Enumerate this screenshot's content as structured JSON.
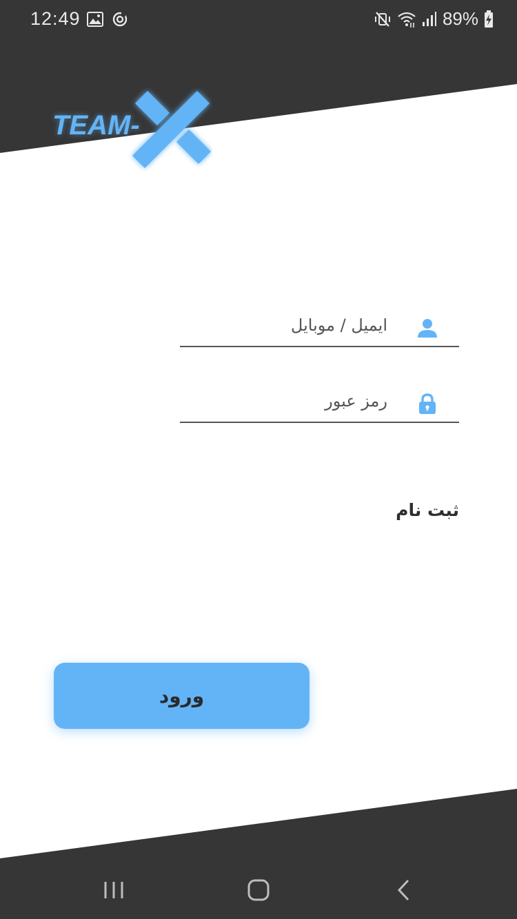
{
  "status_bar": {
    "time": "12:49",
    "battery_percent": "89%",
    "left_icons": [
      "image-icon",
      "sync-icon"
    ],
    "right_icons": [
      "mute-vibrate-icon",
      "wifi-icon",
      "signal-icon",
      "battery-charging-icon"
    ]
  },
  "logo": {
    "text": "TEAM-",
    "mark": "x-mark-icon",
    "color": "#63b4f6"
  },
  "login_form": {
    "email": {
      "placeholder": "ایمیل / موبایل",
      "value": "",
      "icon": "user-icon"
    },
    "password": {
      "placeholder": "رمز عبور",
      "value": "",
      "icon": "lock-icon"
    },
    "register_label": "ثبت نام",
    "login_label": "ورود"
  },
  "nav_bar": {
    "buttons": [
      "recents-icon",
      "home-icon",
      "back-icon"
    ]
  },
  "colors": {
    "accent": "#63b4f6",
    "dark_band": "#363636",
    "background": "#ffffff"
  }
}
